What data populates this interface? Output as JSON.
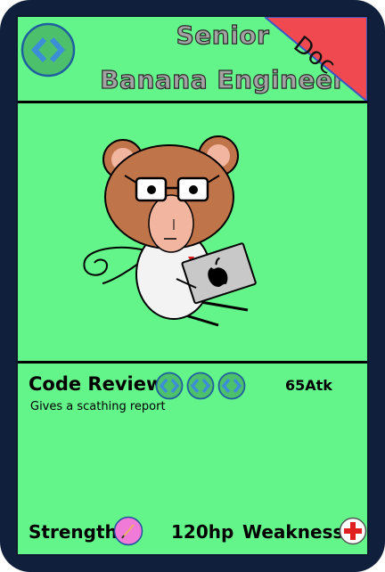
{
  "card": {
    "title_line1": "Senior",
    "title_line2": "Banana Engineer",
    "type_label": "Doc",
    "element_icon": "code-brackets-icon"
  },
  "attack": {
    "name": "Code Review",
    "description": "Gives a scathing report",
    "damage": "65Atk",
    "energy_cost": [
      "code-brackets-icon",
      "code-brackets-icon",
      "code-brackets-icon"
    ]
  },
  "footer": {
    "strength_label": "Strength",
    "strength_icon": "pencil-icon",
    "hp": "120hp",
    "weakness_label": "Weakness",
    "weakness_icon": "red-cross-icon"
  },
  "colors": {
    "card_background": "#64f58a",
    "frame": "#10203c",
    "type_ribbon": "#f04a50",
    "energy_icon": "#4a9bd9",
    "strength_icon": "#f07ad8",
    "weakness_icon": "#e02020"
  }
}
